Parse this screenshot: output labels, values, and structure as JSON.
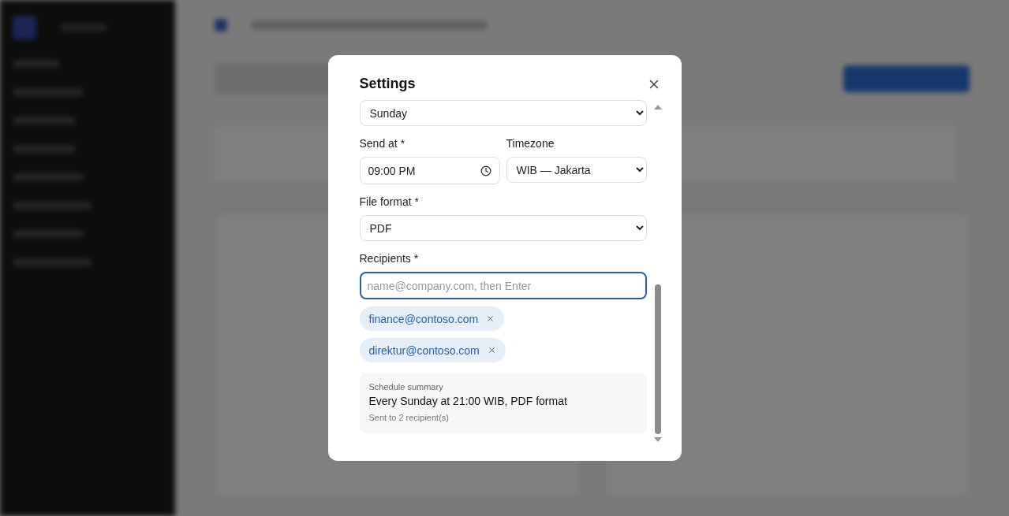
{
  "dialog": {
    "title": "Settings"
  },
  "day": {
    "value": "Sunday"
  },
  "send_at": {
    "label": "Send at *",
    "value": "09:00 PM"
  },
  "timezone": {
    "label": "Timezone",
    "value": "WIB — Jakarta"
  },
  "file_format": {
    "label": "File format *",
    "value": "PDF"
  },
  "recipients": {
    "label": "Recipients *",
    "placeholder": "name@company.com, then Enter",
    "focused": true,
    "chips": [
      {
        "email": "finance@contoso.com"
      },
      {
        "email": "direktur@contoso.com"
      }
    ]
  },
  "summary": {
    "heading": "Schedule summary",
    "text": "Every Sunday at 21:00 WIB, PDF format",
    "note": "Sent to 2 recipient(s)"
  }
}
